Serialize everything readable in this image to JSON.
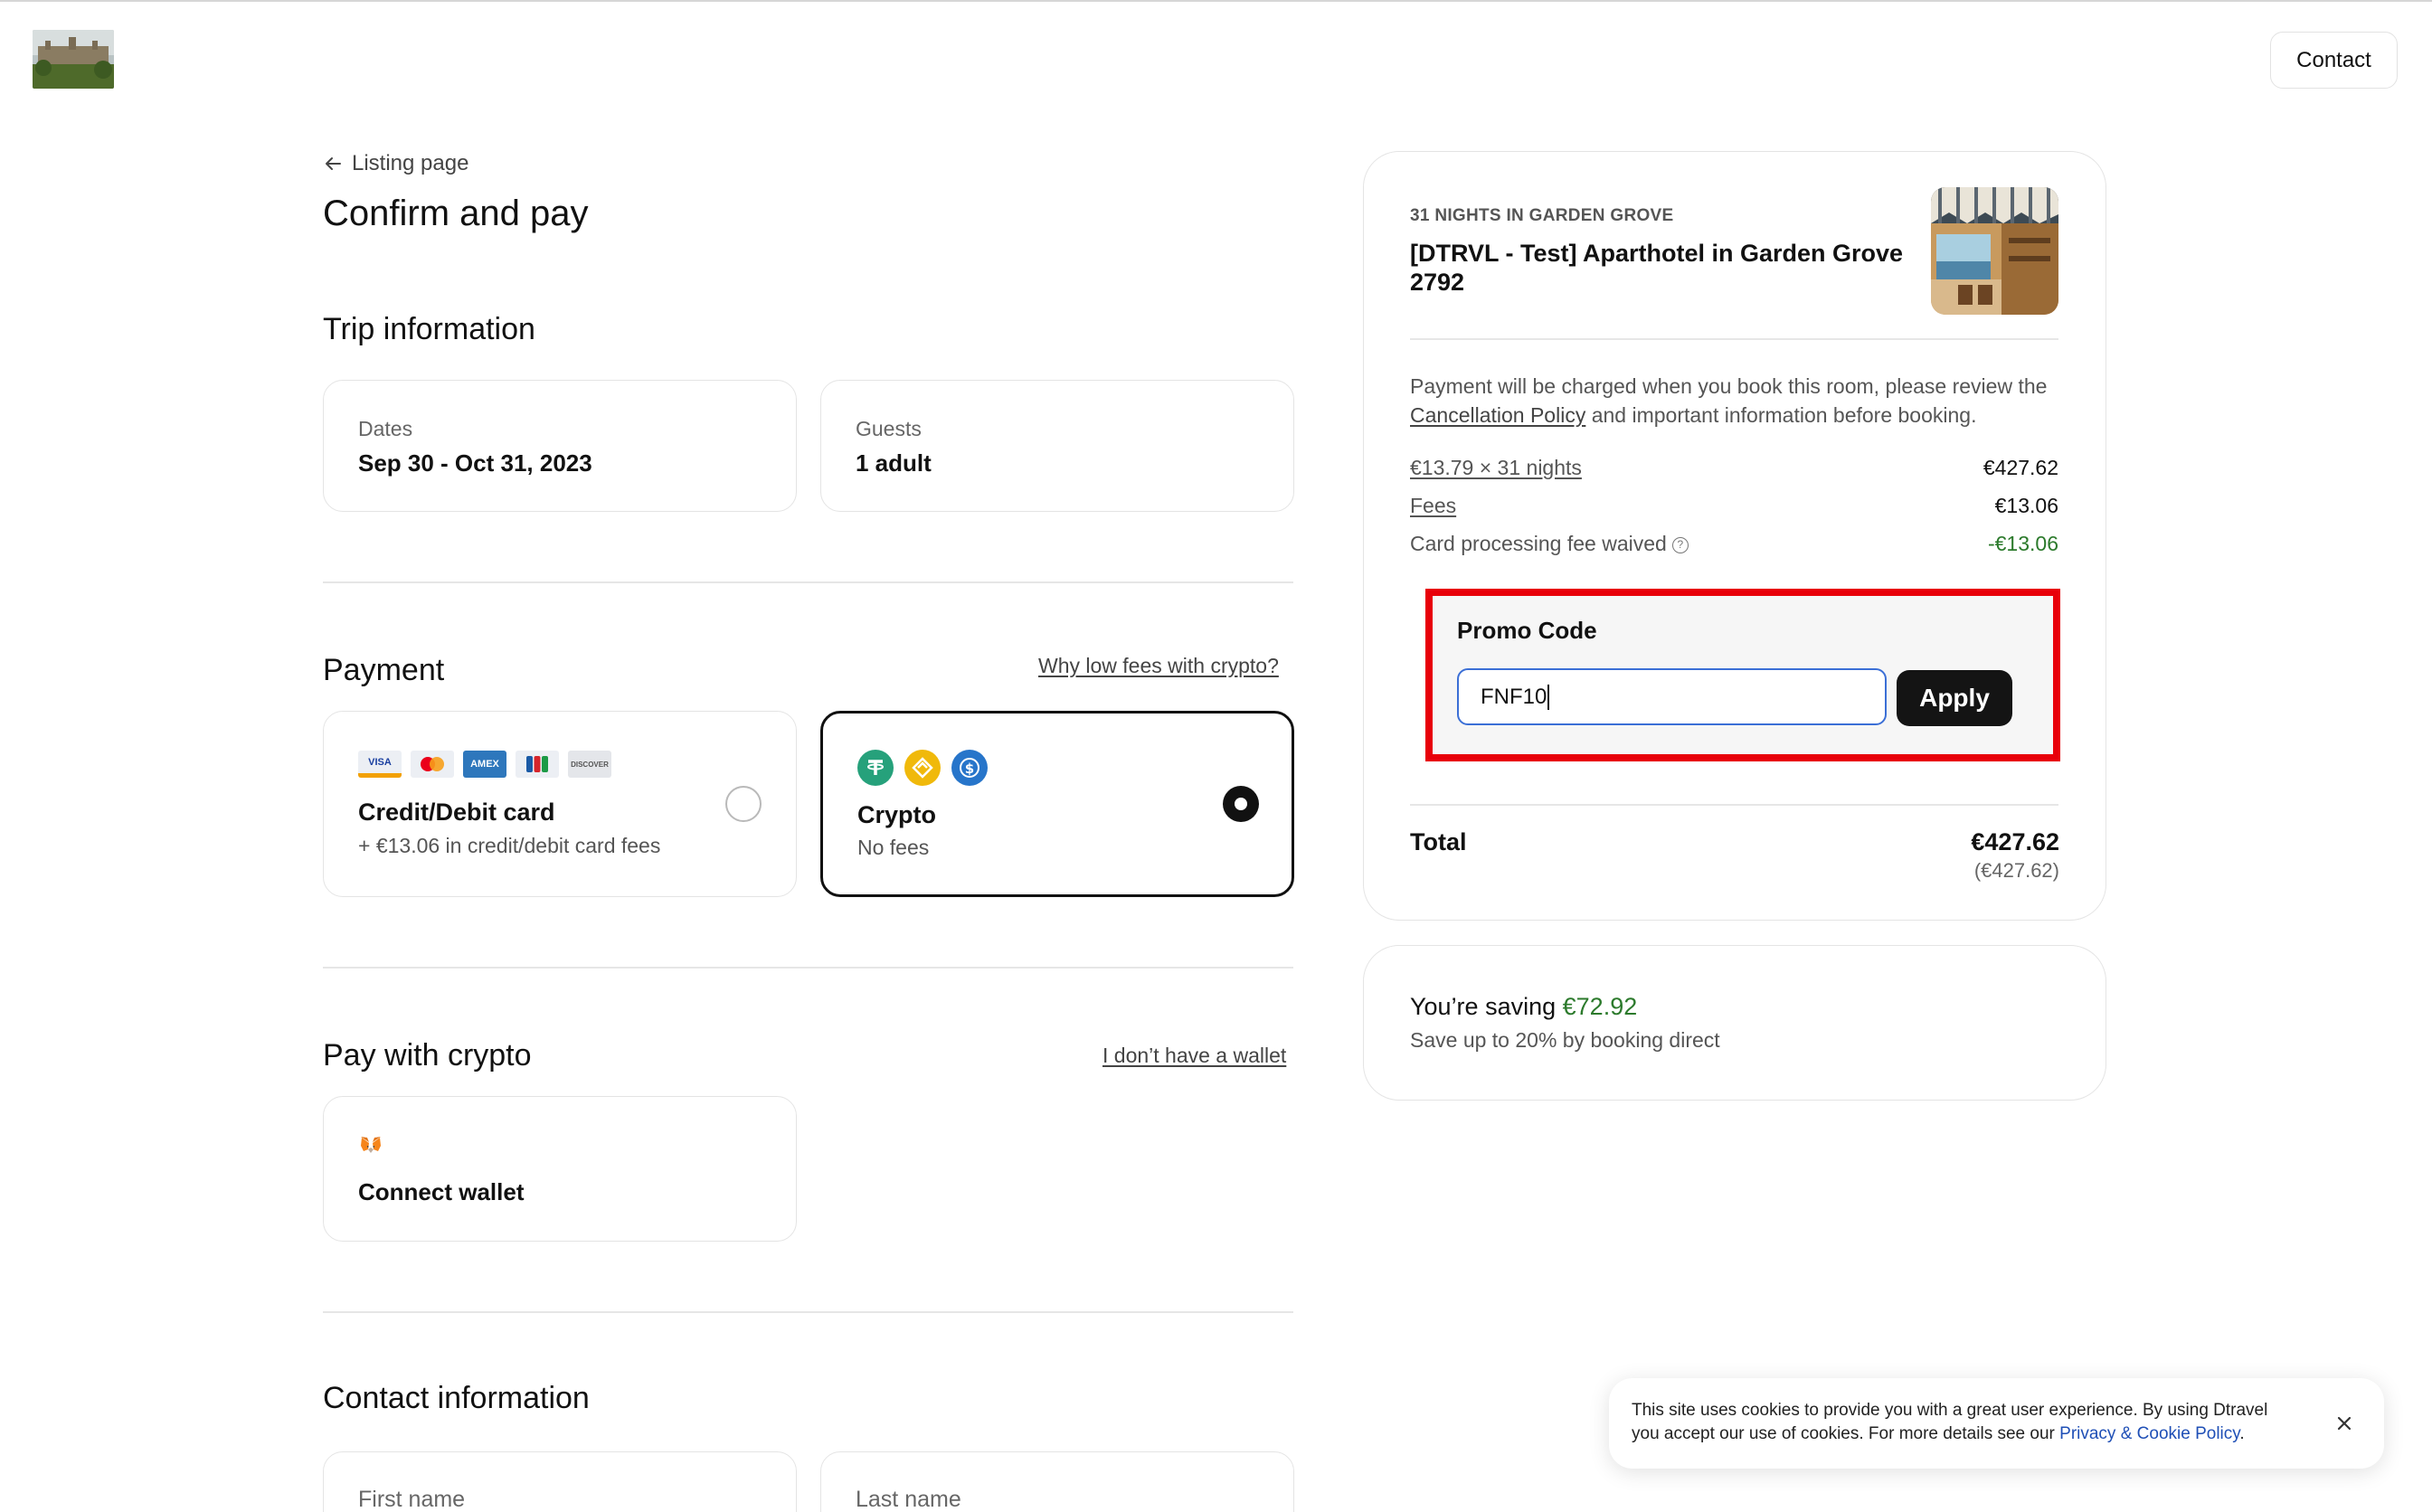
{
  "header": {
    "contact_label": "Contact"
  },
  "nav": {
    "back_label": "Listing page"
  },
  "page_title": "Confirm and pay",
  "trip": {
    "title": "Trip information",
    "dates_label": "Dates",
    "dates_value": "Sep 30 - Oct 31, 2023",
    "guests_label": "Guests",
    "guests_value": "1 adult"
  },
  "payment": {
    "title": "Payment",
    "why_link": "Why low fees with crypto?",
    "card_option": {
      "title": "Credit/Debit card",
      "subtitle": "+ €13.06 in credit/debit card fees",
      "icons": [
        "VISA",
        "MC",
        "AMEX",
        "JCB",
        "DISCOVER"
      ],
      "selected": false
    },
    "crypto_option": {
      "title": "Crypto",
      "subtitle": "No fees",
      "icons": [
        "usdt-icon",
        "busd-icon",
        "usdc-icon"
      ],
      "selected": true
    }
  },
  "pay_with_crypto": {
    "title": "Pay with crypto",
    "no_wallet_link": "I don’t have a wallet",
    "connect_label": "Connect wallet"
  },
  "contact_info": {
    "title": "Contact information",
    "first_name_placeholder": "First name",
    "last_name_placeholder": "Last name"
  },
  "summary": {
    "nights_label": "31 NIGHTS IN GARDEN GROVE",
    "property_title": "[DTRVL - Test] Aparthotel in Garden Grove 2792",
    "notice_before": "Payment will be charged when you book this room, please review the",
    "notice_link": "Cancellation Policy",
    "notice_after": "and important information before booking.",
    "rate_label": "€13.79 × 31 nights",
    "rate_value": "€427.62",
    "fees_label": "Fees",
    "fees_value": "€13.06",
    "waived_label": "Card processing fee waived",
    "waived_value": "-€13.06",
    "promo_label": "Promo Code",
    "promo_value": "FNF10",
    "apply_label": "Apply",
    "total_label": "Total",
    "total_value": "€427.62",
    "total_sub": "(€427.62)"
  },
  "saving": {
    "prefix": "You’re saving",
    "amount": "€72.92",
    "subtitle": "Save up to 20% by booking direct"
  },
  "cookie": {
    "text": "This site uses cookies to provide you with a great user experience. By using Dtravel you accept our use of cookies. For more details see our",
    "link": "Privacy & Cookie Policy",
    "end": "."
  },
  "colors": {
    "accent_green": "#2c7a2c",
    "highlight_red": "#e8000a",
    "input_focus_blue": "#3b6fd6",
    "dark_button": "#141414"
  }
}
